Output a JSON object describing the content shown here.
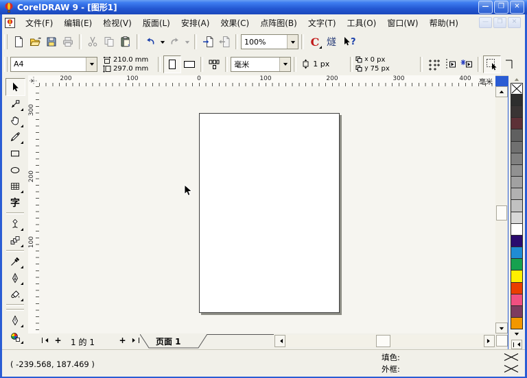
{
  "window": {
    "title": "CorelDRAW 9 - [图形1]",
    "accent_colors": {
      "titlebar_blue": "#2458d2",
      "frame_blue": "#2a5cd4",
      "bar_bg": "#f1f0e9"
    }
  },
  "menu": {
    "items": [
      "文件(F)",
      "编辑(E)",
      "检视(V)",
      "版面(L)",
      "安排(A)",
      "效果(C)",
      "点阵图(B)",
      "文字(T)",
      "工具(O)",
      "窗口(W)",
      "帮助(H)"
    ]
  },
  "standard_toolbar": {
    "zoom_value": "100%",
    "icons": [
      "new-icon",
      "open-icon",
      "save-icon",
      "print-icon",
      "cut-icon",
      "copy-icon",
      "paste-icon",
      "undo-icon",
      "redo-icon",
      "import-icon",
      "export-icon",
      "zoom-level-combo",
      "application-launcher-icon",
      "corel-online-icon",
      "whats-this-icon"
    ]
  },
  "property_bar": {
    "paper_size": "A4",
    "paper_width": "210.0 mm",
    "paper_height": "297.0 mm",
    "units": "毫米",
    "nudge_offset": "1 px",
    "duplicate_x_label": "x",
    "duplicate_x_value": "0 px",
    "duplicate_y_label": "y",
    "duplicate_y_value": "75 px"
  },
  "toolbox": {
    "tools": [
      "pick-tool",
      "shape-tool",
      "pan-tool",
      "freehand-tool",
      "rectangle-tool",
      "ellipse-tool",
      "graph-paper-tool",
      "text-tool",
      "interactive-distortion-tool",
      "interactive-blend-tool",
      "eyedropper-tool",
      "outline-pen-tool",
      "fill-tool",
      "interactive-fill-tool"
    ],
    "text_tool_glyph": "字"
  },
  "rulers": {
    "horizontal_ticks": [
      "200",
      "100",
      "0",
      "100",
      "200",
      "300",
      "400"
    ],
    "horizontal_unit": "毫米",
    "vertical_ticks": [
      "300",
      "200",
      "100"
    ],
    "vertical_unit": "毫米"
  },
  "navigator": {
    "add_page_label": "+",
    "current_page": "1",
    "of_label": "的",
    "total_pages": "1",
    "tab_label": "页面  1"
  },
  "status_bar": {
    "coordinates": "( -239.568,  187.469 )",
    "fill_label": "填色:",
    "outline_label": "外框:"
  },
  "palette": {
    "colors": [
      "#2e2e2e",
      "#3a3434",
      "#5d3137",
      "#606060",
      "#707070",
      "#808080",
      "#919191",
      "#a1a1a1",
      "#b1b1b1",
      "#c1c1c1",
      "#d8d8d8",
      "#ffffff",
      "#2a0b6e",
      "#1f8cd3",
      "#17a14f",
      "#ffef00",
      "#ea3e00",
      "#ef5081",
      "#7d3b5f",
      "#f39700"
    ]
  }
}
